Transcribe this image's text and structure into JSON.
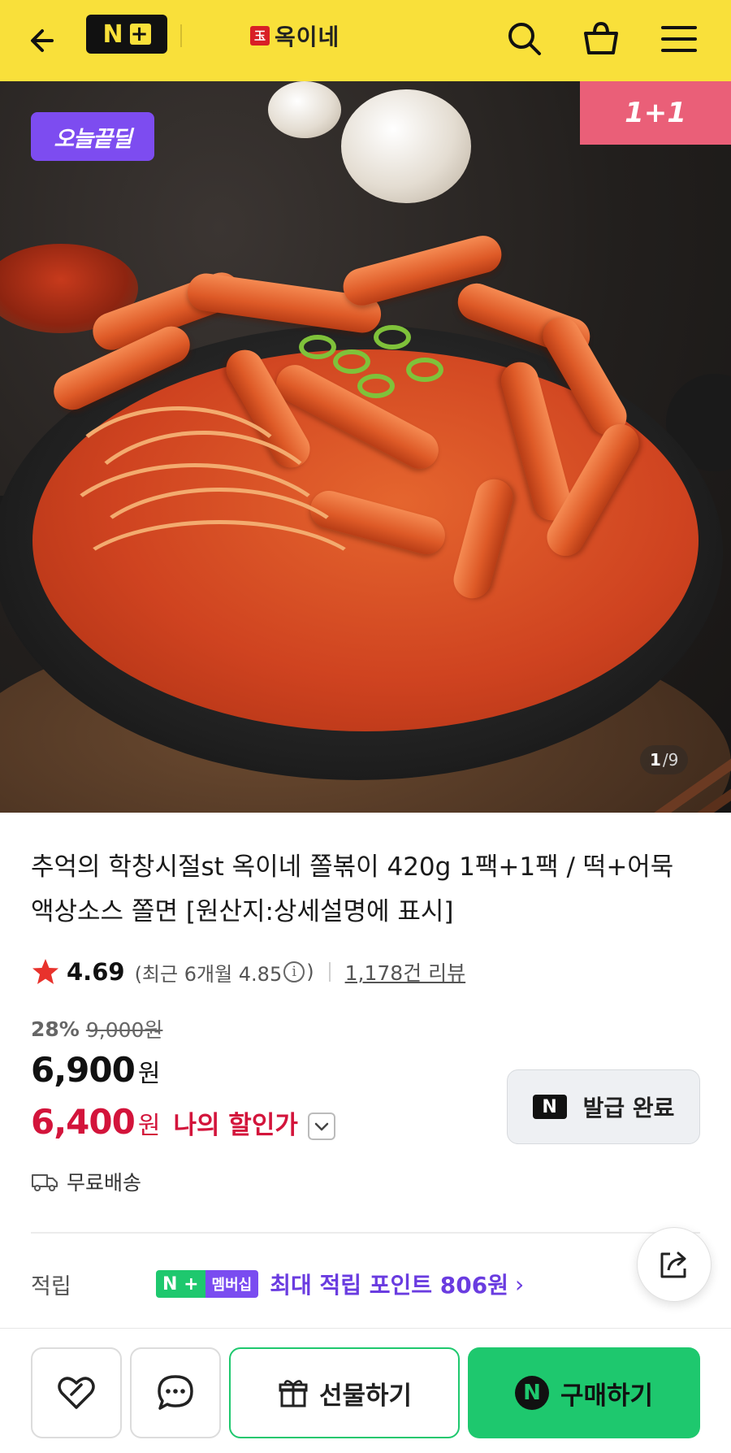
{
  "header": {
    "back_icon": "arrow-left-icon",
    "nplus_label": "N",
    "nplus_plus": "+",
    "brand_mark": "玉",
    "brand_name": "옥이네",
    "search_icon": "search-icon",
    "cart_icon": "shopping-basket-icon",
    "menu_icon": "hamburger-menu-icon",
    "background_color": "#f9e03a"
  },
  "hero": {
    "badge_today": "오늘끝딜",
    "badge_oneplus": "1+1",
    "page_current": "1",
    "page_total": "/9"
  },
  "product": {
    "title": "추억의 학창시절st 옥이네 쫄볶이 420g 1팩+1팩 / 떡+어묵 액상소스 쫄면 [원산지:상세설명에 표시]",
    "rating": "4.69",
    "rating_recent": "(최근 6개월 4.85",
    "rating_recent_close": ")",
    "info_icon": "i",
    "review_count": "1,178건 리뷰",
    "discount_rate": "28%",
    "original_price": "9,000원",
    "price": "6,900",
    "price_unit": "원",
    "my_price": "6,400",
    "my_price_unit": "원",
    "my_price_label": "나의 할인가",
    "coupon_n": "N",
    "coupon_label": "발급 완료",
    "shipping": "무료배송",
    "points_label": "적립",
    "member_n": "N +",
    "member_label": "멤버십",
    "points_text": "최대 적립 포인트 806원",
    "points_chevron": "›"
  },
  "bottom": {
    "gift_label": "선물하기",
    "buy_n": "N",
    "buy_label": "구매하기",
    "buy_color": "#1ec86e"
  },
  "colors": {
    "accent_red": "#d3143b",
    "accent_purple": "#6a3ce0",
    "brand_green": "#1ec86e",
    "badge_pink": "#ea5f78"
  }
}
